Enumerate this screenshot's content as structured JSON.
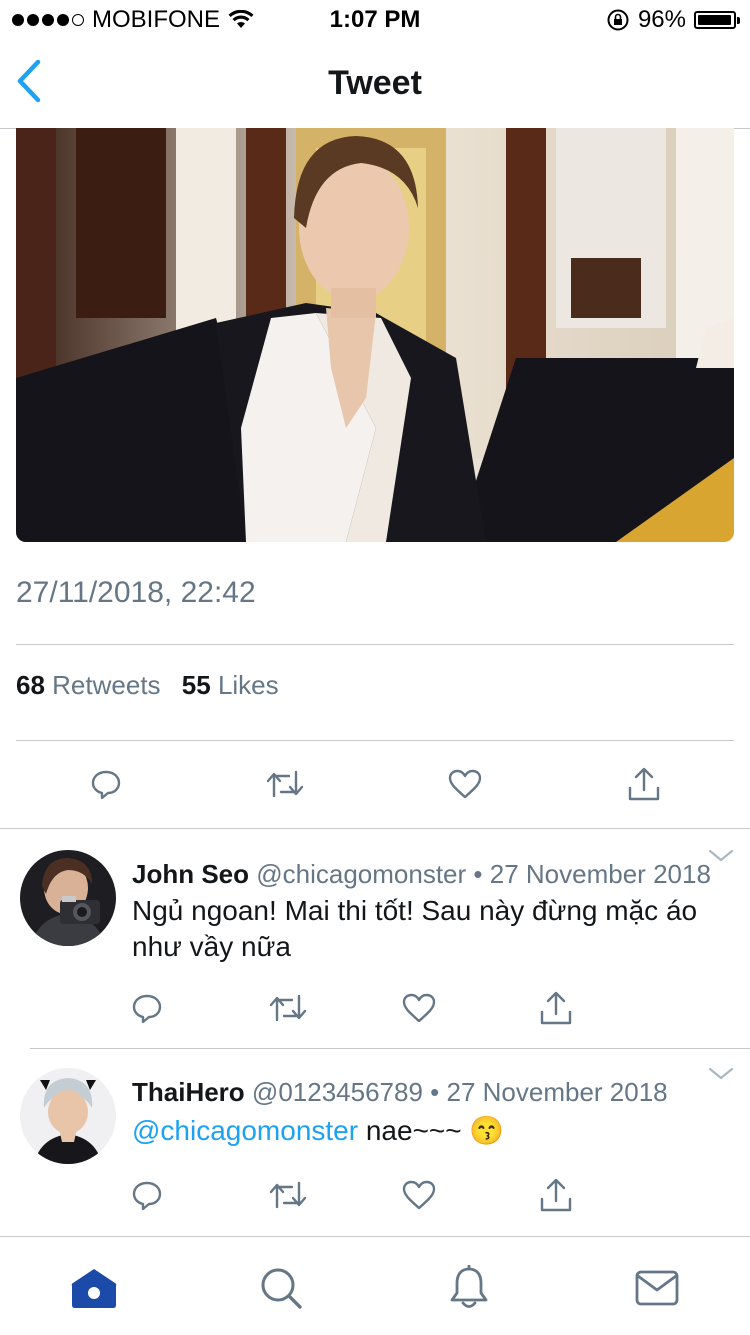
{
  "status_bar": {
    "carrier": "MOBIFONE",
    "time": "1:07 PM",
    "battery_percent": "96%",
    "battery_level": 0.96
  },
  "nav": {
    "title": "Tweet"
  },
  "tweet": {
    "datetime": "27/11/2018, 22:42",
    "retweets_count": "68",
    "retweets_label": "Retweets",
    "likes_count": "55",
    "likes_label": "Likes"
  },
  "replies": [
    {
      "name": "John Seo",
      "handle": "@chicagomonster",
      "dot": "•",
      "date": "27 November 2018",
      "text": "Ngủ ngoan! Mai thi tốt! Sau này đừng mặc áo như vầy nữa"
    },
    {
      "name": "ThaiHero",
      "handle": "@0123456789",
      "dot": "•",
      "date": "27 November 2018",
      "mention": "@chicagomonster",
      "text": "nae~~~",
      "emoji": "😙"
    }
  ],
  "colors": {
    "accent": "#1da1f2",
    "muted": "#657786",
    "icon": "#657786",
    "home_active": "#1b4aa8"
  },
  "icons": [
    "back-icon",
    "wifi-icon",
    "lock-rotation-icon",
    "reply-icon",
    "retweet-icon",
    "like-icon",
    "share-icon",
    "home-icon",
    "search-icon",
    "notifications-icon",
    "messages-icon"
  ]
}
